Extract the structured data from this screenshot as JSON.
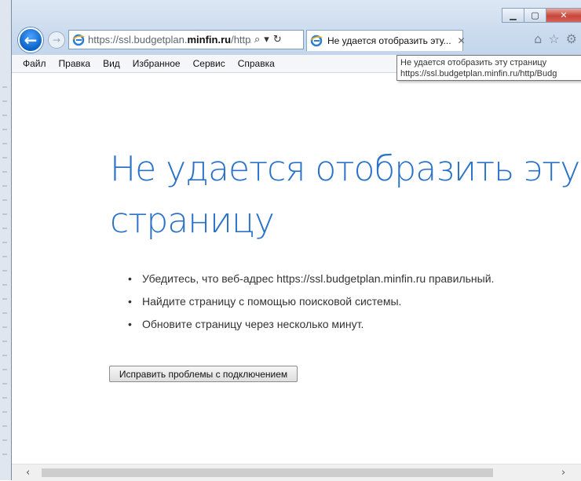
{
  "window": {
    "minimize_icon": "minimize-icon",
    "maximize_icon": "maximize-icon",
    "close_icon": "close-icon",
    "minimize_glyph": "▁",
    "maximize_glyph": "▢",
    "close_glyph": "✕"
  },
  "nav": {
    "back_glyph": "←",
    "forward_glyph": "→"
  },
  "address": {
    "url_prefix": "https://ssl.budgetplan.",
    "url_domain": "minfin.ru",
    "url_suffix": "/http/Bu",
    "search_glyph": "⌕",
    "dropdown_glyph": "▾",
    "refresh_glyph": "↻"
  },
  "tab": {
    "title": "Не удается отобразить эту...",
    "close_glyph": "✕"
  },
  "toolbar_icons": {
    "home_glyph": "⌂",
    "favorites_glyph": "☆",
    "settings_glyph": "⚙"
  },
  "menu": [
    "Файл",
    "Правка",
    "Вид",
    "Избранное",
    "Сервис",
    "Справка"
  ],
  "tooltip": {
    "line1": "Не удается отобразить эту страницу",
    "line2": "https://ssl.budgetplan.minfin.ru/http/Budg"
  },
  "page": {
    "title": "Не удается отобразить эту страницу",
    "tips": [
      "Убедитесь, что веб-адрес https://ssl.budgetplan.minfin.ru правильный.",
      "Найдите страницу с помощью поисковой системы.",
      "Обновите страницу через несколько минут."
    ],
    "bullet": "•",
    "fix_button": "Исправить проблемы с подключением"
  },
  "scrollbar": {
    "left_glyph": "‹",
    "right_glyph": "›"
  },
  "colors": {
    "title_blue": "#2b72c9",
    "back_button": "#0a62c8",
    "close_button": "#c8453a"
  }
}
